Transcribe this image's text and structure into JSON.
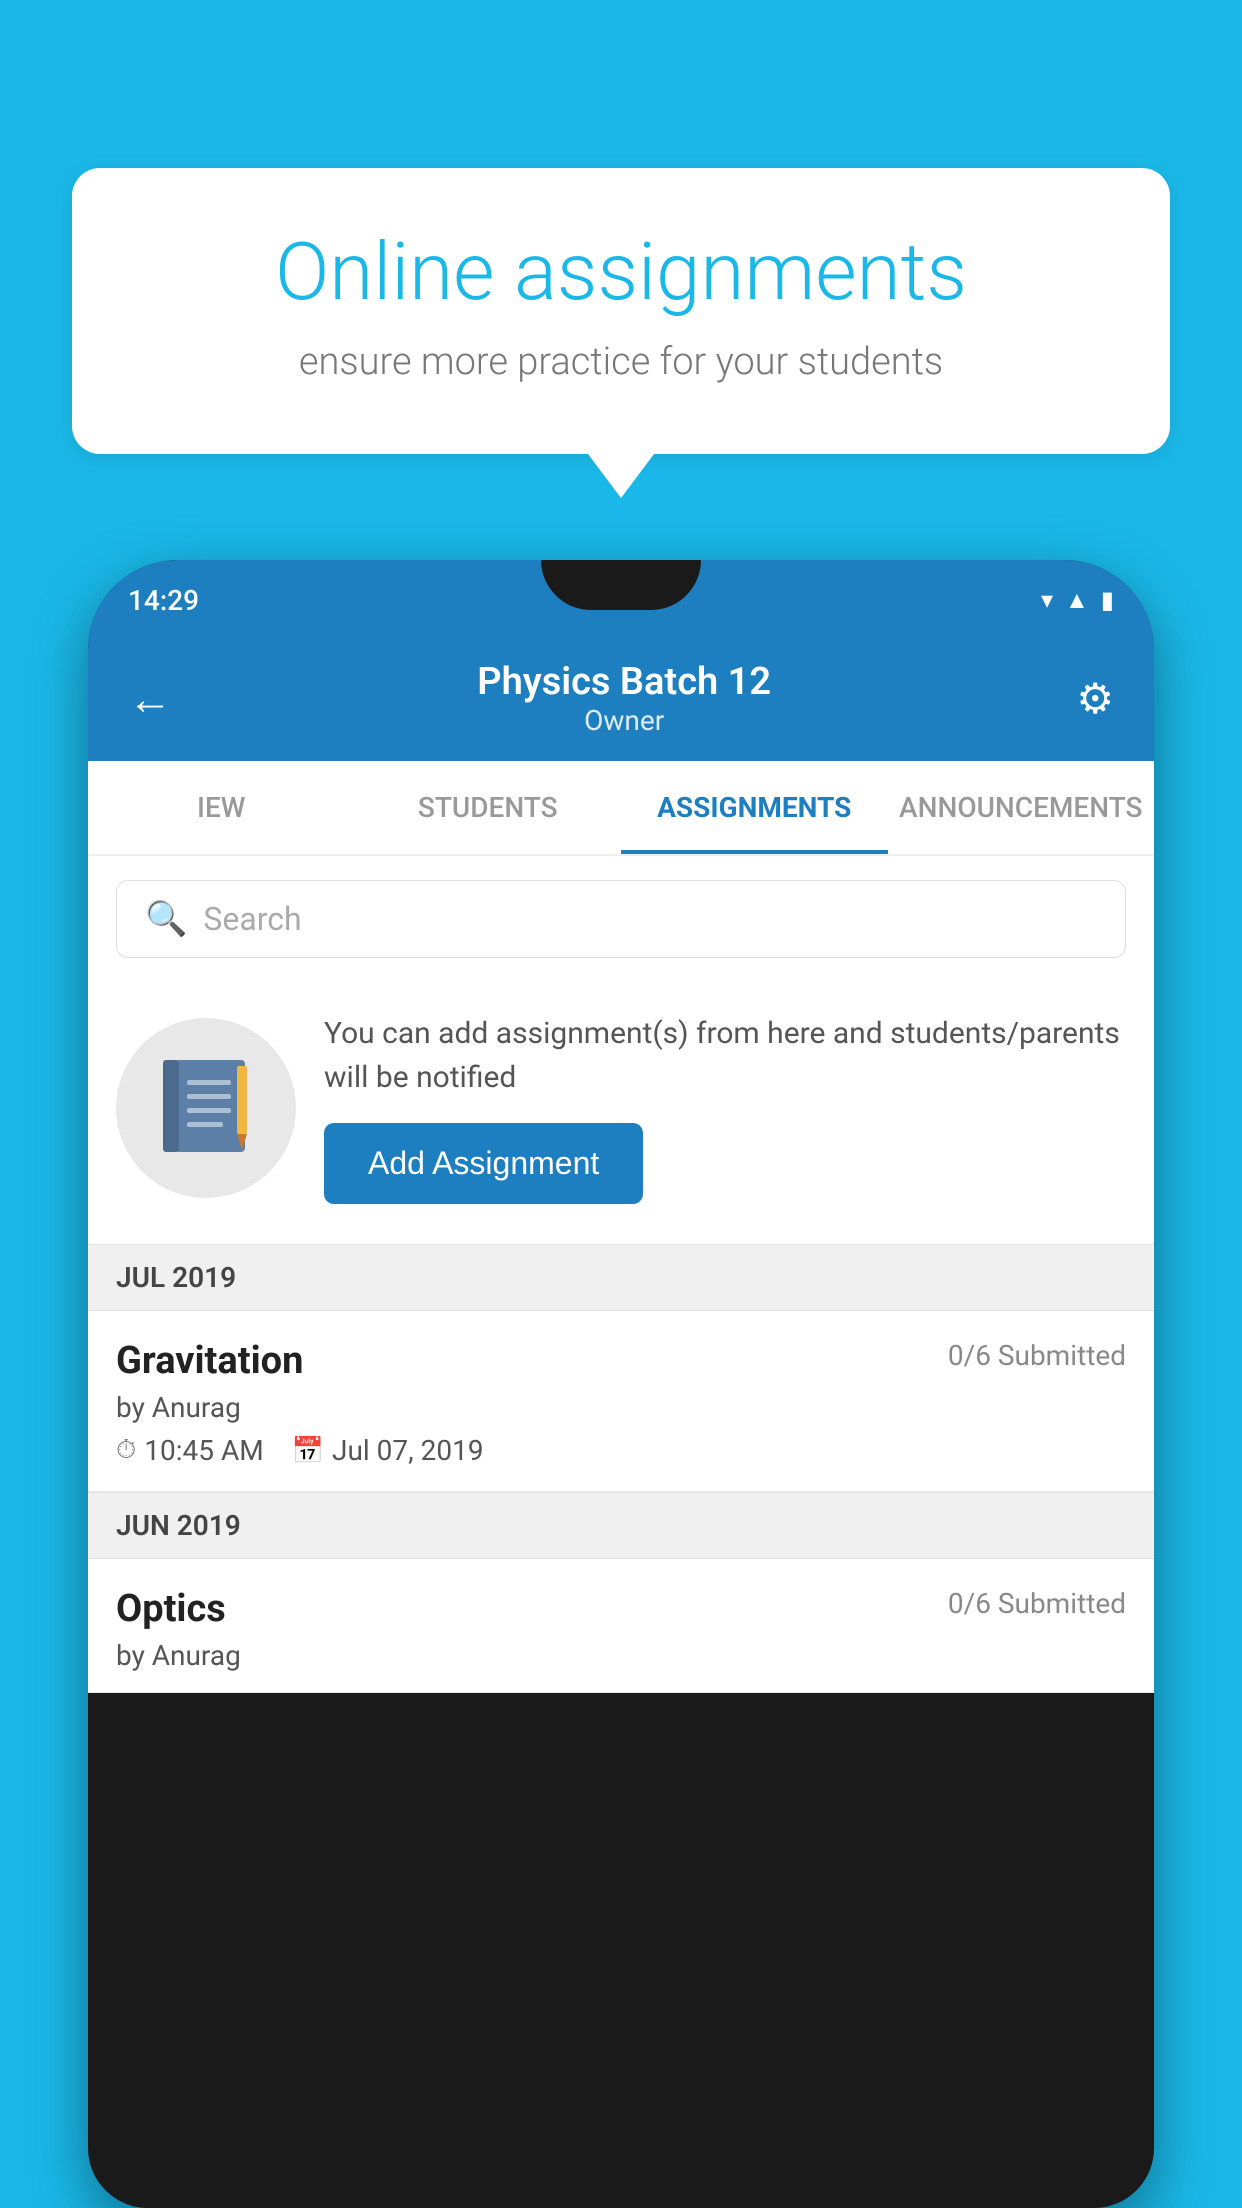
{
  "background": {
    "color": "#1ab8e8"
  },
  "speech_bubble": {
    "title": "Online assignments",
    "subtitle": "ensure more practice for your students"
  },
  "phone": {
    "status_bar": {
      "time": "14:29"
    },
    "header": {
      "title": "Physics Batch 12",
      "subtitle": "Owner"
    },
    "tabs": [
      {
        "label": "IEW",
        "active": false
      },
      {
        "label": "STUDENTS",
        "active": false
      },
      {
        "label": "ASSIGNMENTS",
        "active": true
      },
      {
        "label": "ANNOUNCEMENTS",
        "active": false
      }
    ],
    "search": {
      "placeholder": "Search"
    },
    "promo": {
      "description": "You can add assignment(s) from here and students/parents will be notified",
      "button_label": "Add Assignment"
    },
    "sections": [
      {
        "label": "JUL 2019",
        "assignments": [
          {
            "title": "Gravitation",
            "submitted": "0/6 Submitted",
            "author": "by Anurag",
            "time": "10:45 AM",
            "date": "Jul 07, 2019"
          }
        ]
      },
      {
        "label": "JUN 2019",
        "assignments": [
          {
            "title": "Optics",
            "submitted": "0/6 Submitted",
            "author": "by Anurag",
            "time": "",
            "date": ""
          }
        ]
      }
    ]
  }
}
